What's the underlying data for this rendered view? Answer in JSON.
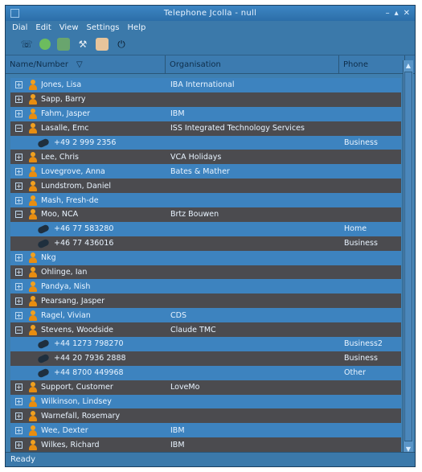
{
  "window": {
    "title": "Telephone Jcolla - null"
  },
  "menu": {
    "items": [
      "Dial",
      "Edit",
      "View",
      "Settings",
      "Help"
    ]
  },
  "toolbar": {
    "icons": [
      "phone-icon",
      "globe-icon",
      "address-icon",
      "tools-icon",
      "copy-icon",
      "power-icon"
    ]
  },
  "columns": {
    "name": "Name/Number",
    "org": "Organisation",
    "phone": "Phone"
  },
  "rows": [
    {
      "kind": "contact",
      "name": "Jones, Lisa",
      "org": "IBA International",
      "phone": ""
    },
    {
      "kind": "contact",
      "name": "Sapp, Barry",
      "org": "",
      "phone": ""
    },
    {
      "kind": "contact",
      "name": "Fahm, Jasper",
      "org": "IBM",
      "phone": ""
    },
    {
      "kind": "contact",
      "name": "Lasalle, Emc",
      "org": "ISS Integrated Technology Services",
      "phone": ""
    },
    {
      "kind": "number",
      "name": "+49 2 999 2356",
      "org": "",
      "phone": "Business"
    },
    {
      "kind": "contact",
      "name": "Lee, Chris",
      "org": "VCA Holidays",
      "phone": ""
    },
    {
      "kind": "contact",
      "name": "Lovegrove, Anna",
      "org": "Bates & Mather",
      "phone": ""
    },
    {
      "kind": "contact",
      "name": "Lundstrom, Daniel",
      "org": "",
      "phone": ""
    },
    {
      "kind": "contact",
      "name": "Mash, Fresh-de",
      "org": "",
      "phone": ""
    },
    {
      "kind": "contact",
      "name": "Moo, NCA",
      "org": "Brtz Bouwen",
      "phone": ""
    },
    {
      "kind": "number",
      "name": "+46 77 583280",
      "org": "",
      "phone": "Home"
    },
    {
      "kind": "number",
      "name": "+46 77 436016",
      "org": "",
      "phone": "Business"
    },
    {
      "kind": "contact",
      "name": "Nkg",
      "org": "",
      "phone": ""
    },
    {
      "kind": "contact",
      "name": "Ohlinge, Ian",
      "org": "",
      "phone": ""
    },
    {
      "kind": "contact",
      "name": "Pandya, Nish",
      "org": "",
      "phone": ""
    },
    {
      "kind": "contact",
      "name": "Pearsang, Jasper",
      "org": "",
      "phone": ""
    },
    {
      "kind": "contact",
      "name": "Ragel, Vivian",
      "org": "CDS",
      "phone": ""
    },
    {
      "kind": "contact",
      "name": "Stevens, Woodside",
      "org": "Claude TMC",
      "phone": ""
    },
    {
      "kind": "number",
      "name": "+44 1273 798270",
      "org": "",
      "phone": "Business2"
    },
    {
      "kind": "number",
      "name": "+44 20 7936 2888",
      "org": "",
      "phone": "Business"
    },
    {
      "kind": "number",
      "name": "+44 8700 449968",
      "org": "",
      "phone": "Other"
    },
    {
      "kind": "contact",
      "name": "Support, Customer",
      "org": "LoveMo",
      "phone": ""
    },
    {
      "kind": "contact",
      "name": "Wilkinson, Lindsey",
      "org": "",
      "phone": ""
    },
    {
      "kind": "contact",
      "name": "Warnefall, Rosemary",
      "org": "",
      "phone": ""
    },
    {
      "kind": "contact",
      "name": "Wee, Dexter",
      "org": "IBM",
      "phone": ""
    },
    {
      "kind": "contact",
      "name": "Wilkes, Richard",
      "org": "IBM",
      "phone": ""
    }
  ],
  "status": {
    "text": "Ready"
  }
}
